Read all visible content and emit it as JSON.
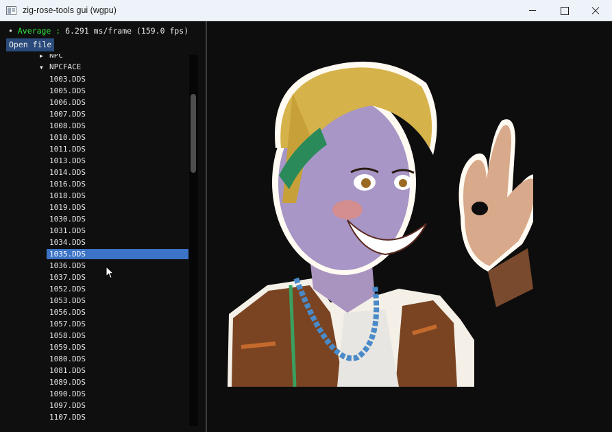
{
  "window": {
    "title": "zig-rose-tools gui (wgpu)"
  },
  "stats": {
    "bullet": "•",
    "label": "Average :",
    "value": "6.291 ms/frame (159.0 fps)"
  },
  "toolbar": {
    "open_file_label": "Open file"
  },
  "tree": {
    "npc_label": "NPC",
    "npcface_label": "NPCFACE",
    "selected_index": 15,
    "files": [
      "1003.DDS",
      "1005.DDS",
      "1006.DDS",
      "1007.DDS",
      "1008.DDS",
      "1010.DDS",
      "1011.DDS",
      "1013.DDS",
      "1014.DDS",
      "1016.DDS",
      "1018.DDS",
      "1019.DDS",
      "1030.DDS",
      "1031.DDS",
      "1034.DDS",
      "1035.DDS",
      "1036.DDS",
      "1037.DDS",
      "1052.DDS",
      "1053.DDS",
      "1056.DDS",
      "1057.DDS",
      "1058.DDS",
      "1059.DDS",
      "1080.DDS",
      "1081.DDS",
      "1089.DDS",
      "1090.DDS",
      "1097.DDS",
      "1107.DDS"
    ]
  },
  "icons": {
    "collapsed": "▶",
    "expanded": "▼"
  },
  "colors": {
    "selection": "#3b73c6",
    "fps_label": "#2ee83e",
    "button": "#294a7a"
  }
}
